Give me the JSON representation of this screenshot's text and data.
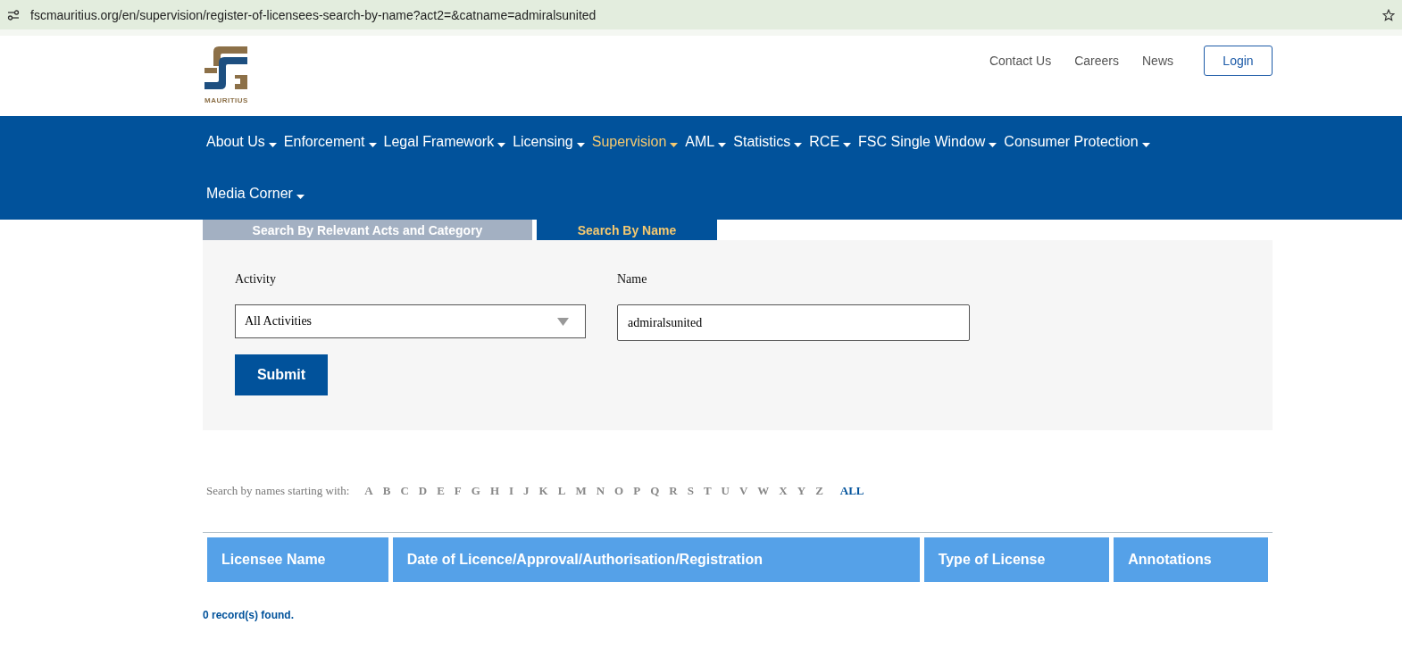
{
  "browser": {
    "url": "fscmauritius.org/en/supervision/register-of-licensees-search-by-name?act2=&catname=admiralsunited"
  },
  "header": {
    "logo_caption": "MAURITIUS",
    "links": [
      "Contact Us",
      "Careers",
      "News"
    ],
    "login": "Login"
  },
  "nav": [
    {
      "label": "About Us",
      "selected": false
    },
    {
      "label": "Enforcement",
      "selected": false
    },
    {
      "label": "Legal Framework",
      "selected": false
    },
    {
      "label": "Licensing",
      "selected": false
    },
    {
      "label": "Supervision",
      "selected": true
    },
    {
      "label": "AML",
      "selected": false
    },
    {
      "label": "Statistics",
      "selected": false
    },
    {
      "label": "RCE",
      "selected": false
    },
    {
      "label": "FSC Single Window",
      "selected": false
    },
    {
      "label": "Consumer Protection",
      "selected": false
    },
    {
      "label": "Media Corner",
      "selected": false
    }
  ],
  "tabs": [
    {
      "label": "Search By Relevant Acts and Category",
      "selected": false
    },
    {
      "label": "Search By Name",
      "selected": true
    }
  ],
  "form": {
    "activity_label": "Activity",
    "activity_value": "All Activities",
    "name_label": "Name",
    "name_value": "admiralsunited",
    "submit": "Submit"
  },
  "letters": {
    "prompt": "Search by names starting with:",
    "items": [
      {
        "label": "A",
        "selected": false
      },
      {
        "label": "B",
        "selected": false
      },
      {
        "label": "C",
        "selected": false
      },
      {
        "label": "D",
        "selected": false
      },
      {
        "label": "E",
        "selected": false
      },
      {
        "label": "F",
        "selected": false
      },
      {
        "label": "G",
        "selected": false
      },
      {
        "label": "H",
        "selected": false
      },
      {
        "label": "I",
        "selected": false
      },
      {
        "label": "J",
        "selected": false
      },
      {
        "label": "K",
        "selected": false
      },
      {
        "label": "L",
        "selected": false
      },
      {
        "label": "M",
        "selected": false
      },
      {
        "label": "N",
        "selected": false
      },
      {
        "label": "O",
        "selected": false
      },
      {
        "label": "P",
        "selected": false
      },
      {
        "label": "Q",
        "selected": false
      },
      {
        "label": "R",
        "selected": false
      },
      {
        "label": "S",
        "selected": false
      },
      {
        "label": "T",
        "selected": false
      },
      {
        "label": "U",
        "selected": false
      },
      {
        "label": "V",
        "selected": false
      },
      {
        "label": "W",
        "selected": false
      },
      {
        "label": "X",
        "selected": false
      },
      {
        "label": "Y",
        "selected": false
      },
      {
        "label": "Z",
        "selected": false
      },
      {
        "label": "ALL",
        "selected": true
      }
    ]
  },
  "table": {
    "columns": [
      "Licensee Name",
      "Date of Licence/Approval/Authorisation/Registration",
      "Type of License",
      "Annotations"
    ]
  },
  "status": "0 record(s) found."
}
